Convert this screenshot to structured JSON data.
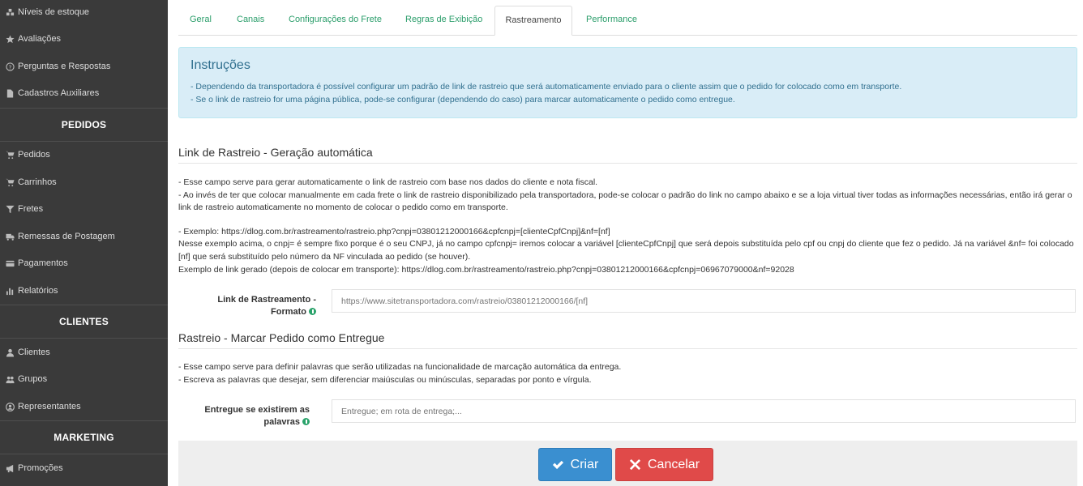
{
  "sidebar": {
    "items_top": [
      {
        "label": "Níveis de estoque",
        "icon": "cubes-icon"
      },
      {
        "label": "Avaliações",
        "icon": "star-icon"
      },
      {
        "label": "Perguntas e Respostas",
        "icon": "question-circle-icon"
      },
      {
        "label": "Cadastros Auxiliares",
        "icon": "file-icon"
      }
    ],
    "section_pedidos": "PEDIDOS",
    "items_pedidos": [
      {
        "label": "Pedidos",
        "icon": "cart-icon"
      },
      {
        "label": "Carrinhos",
        "icon": "cart-icon"
      },
      {
        "label": "Fretes",
        "icon": "filter-icon"
      },
      {
        "label": "Remessas de Postagem",
        "icon": "truck-icon"
      },
      {
        "label": "Pagamentos",
        "icon": "credit-card-icon"
      },
      {
        "label": "Relatórios",
        "icon": "bar-chart-icon"
      }
    ],
    "section_clientes": "CLIENTES",
    "items_clientes": [
      {
        "label": "Clientes",
        "icon": "user-icon"
      },
      {
        "label": "Grupos",
        "icon": "users-icon"
      },
      {
        "label": "Representantes",
        "icon": "user-circle-icon"
      }
    ],
    "section_marketing": "MARKETING",
    "items_marketing": [
      {
        "label": "Promoções",
        "icon": "bullhorn-icon"
      }
    ]
  },
  "tabs": [
    "Geral",
    "Canais",
    "Configurações do Frete",
    "Regras de Exibição",
    "Rastreamento",
    "Performance"
  ],
  "active_tab": "Rastreamento",
  "instructions": {
    "title": "Instruções",
    "line1": "- Dependendo da transportadora é possível configurar um padrão de link de rastreio que será automaticamente enviado para o cliente assim que o pedido for colocado como em transporte.",
    "line2": "- Se o link de rastreio for uma página pública, pode-se configurar (dependendo do caso) para marcar automaticamente o pedido como entregue."
  },
  "section1": {
    "title": "Link de Rastreio - Geração automática",
    "p1": "- Esse campo serve para gerar automaticamente o link de rastreio com base nos dados do cliente e nota fiscal.",
    "p2": "- Ao invés de ter que colocar manualmente em cada frete o link de rastreio disponibilizado pela transportadora, pode-se colocar o padrão do link no campo abaixo e se a loja virtual tiver todas as informações necessárias, então irá gerar o link de rastreio automaticamente no momento de colocar o pedido como em transporte.",
    "p3": "- Exemplo: https://dlog.com.br/rastreamento/rastreio.php?cnpj=03801212000166&cpfcnpj=[clienteCpfCnpj]&nf=[nf]",
    "p4": "Nesse exemplo acima, o cnpj= é sempre fixo porque é o seu CNPJ, já no campo cpfcnpj= iremos colocar a variável [clienteCpfCnpj] que será depois substituída pelo cpf ou cnpj do cliente que fez o pedido. Já na variável &nf= foi colocado [nf] que será substituído pelo número da NF vinculada ao pedido (se houver).",
    "p5": "Exemplo de link gerado (depois de colocar em transporte): https://dlog.com.br/rastreamento/rastreio.php?cnpj=03801212000166&cpfcnpj=06967079000&nf=92028",
    "label_line1": "Link de Rastreamento -",
    "label_line2": "Formato",
    "placeholder": "https://www.sitetransportadora.com/rastreio/03801212000166/[nf]"
  },
  "section2": {
    "title": "Rastreio - Marcar Pedido como Entregue",
    "p1": "- Esse campo serve para definir palavras que serão utilizadas na funcionalidade de marcação automática da entrega.",
    "p2": "- Escreva as palavras que desejar, sem diferenciar maiúsculas ou minúsculas, separadas por ponto e vírgula.",
    "label_line1": "Entregue se existirem as",
    "label_line2": "palavras",
    "placeholder": "Entregue; em rota de entrega;..."
  },
  "buttons": {
    "create": "Criar",
    "cancel": "Cancelar"
  },
  "colors": {
    "sidebar_bg": "#3a3a3a",
    "tab_link": "#2a9d6a",
    "alert_bg": "#d9edf7",
    "primary": "#3a8fd0",
    "danger": "#e04a49"
  }
}
